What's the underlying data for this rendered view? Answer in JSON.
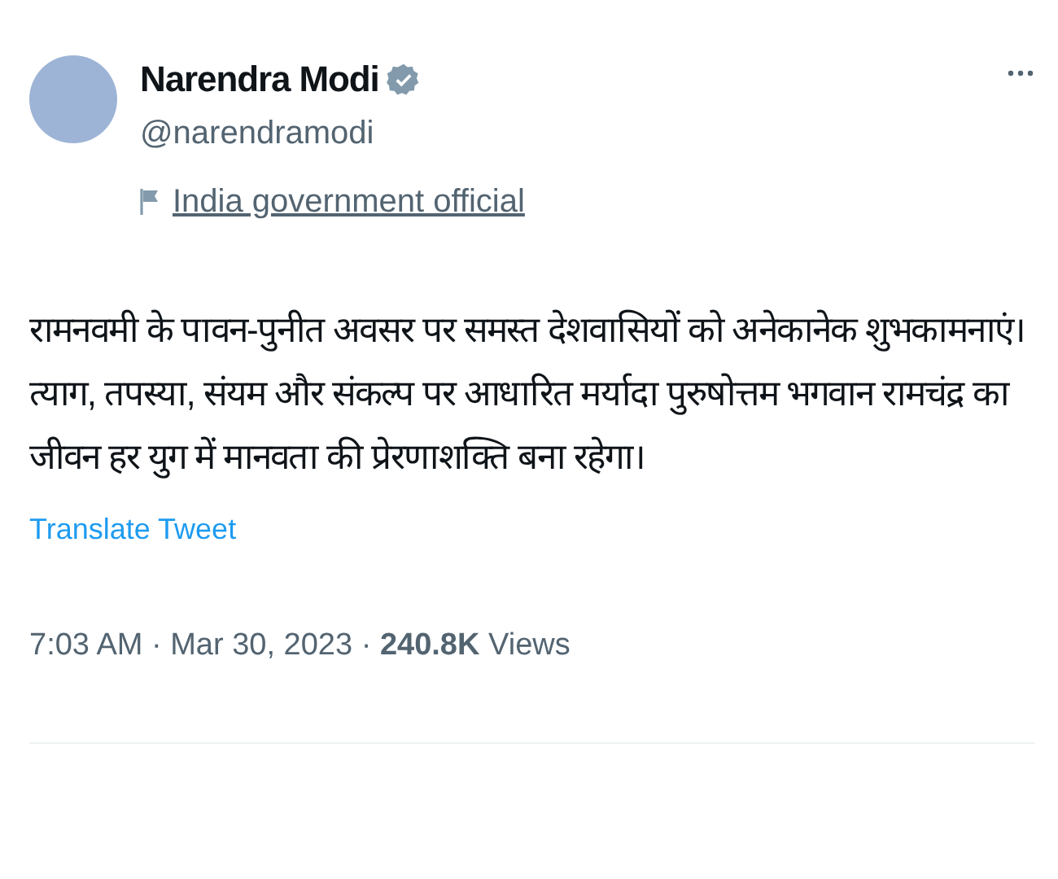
{
  "author": {
    "name": "Narendra Modi",
    "verified": true,
    "handle": "@narendramodi",
    "label": "India government official"
  },
  "tweet_text": "रामनवमी के पावन-पुनीत अवसर पर समस्त देशवासियों को अनेकानेक शुभकामनाएं। त्याग, तपस्या, संयम और संकल्प पर आधारित मर्यादा पुरुषोत्तम भगवान रामचंद्र का जीवन हर युग में मानवता की प्रेरणाशक्ति बना रहेगा।",
  "translate_link": "Translate Tweet",
  "meta": "7:03 AM · Mar 30, 2023 · **240.8K** Views"
}
